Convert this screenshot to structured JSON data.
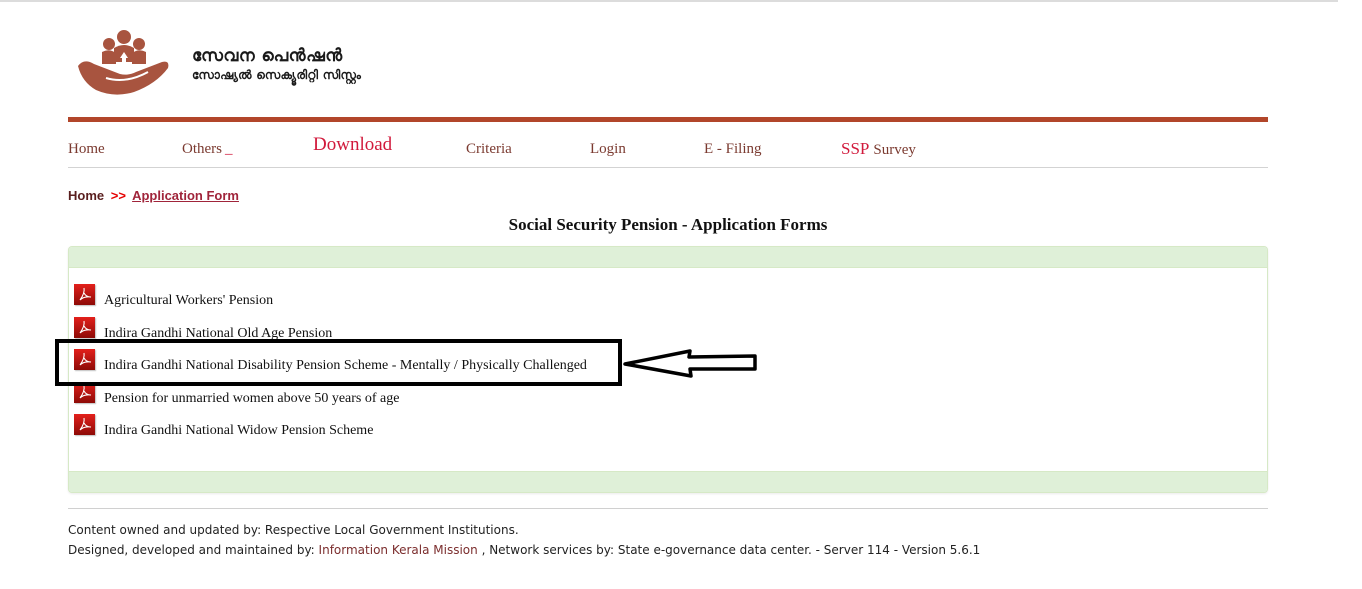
{
  "brand": {
    "title": "സേവന പെൻഷൻ",
    "subtitle": "സോഷ്യൽ സെക്യൂരിറ്റി സിസ്റ്റം",
    "logo_icon": "hand-holding-people-icon",
    "bar_color": "#b2462a"
  },
  "nav": {
    "home": "Home",
    "others": "Others",
    "others_suffix": "_",
    "download": "Download",
    "criteria": "Criteria",
    "login": "Login",
    "efiling": "E - Filing",
    "ssp": "SSP",
    "survey": "Survey"
  },
  "breadcrumb": {
    "home": "Home",
    "separator": ">>",
    "current": "Application Form"
  },
  "page_title": "Social Security Pension - Application Forms",
  "forms": [
    {
      "label": "Agricultural Workers' Pension",
      "icon": "pdf-icon"
    },
    {
      "label": "Indira Gandhi National Old Age Pension",
      "icon": "pdf-icon"
    },
    {
      "label": "Indira Gandhi National Disability Pension Scheme - Mentally / Physically Challenged",
      "icon": "pdf-icon",
      "highlighted": true
    },
    {
      "label": "Pension for unmarried women above 50 years of age",
      "icon": "pdf-icon"
    },
    {
      "label": "Indira Gandhi National Widow Pension Scheme",
      "icon": "pdf-icon"
    }
  ],
  "annotation": {
    "type": "highlight-box-with-arrow",
    "target": "Indira Gandhi National Disability Pension Scheme - Mentally / Physically Challenged"
  },
  "footer": {
    "line1": "Content owned and updated by: Respective Local Government Institutions.",
    "line2_prefix": "Designed, developed and maintained by: ",
    "line2_link": "Information Kerala Mission",
    "line2_suffix": " , Network services by: State e-governance data center. - Server 114 - Version 5.6.1"
  }
}
